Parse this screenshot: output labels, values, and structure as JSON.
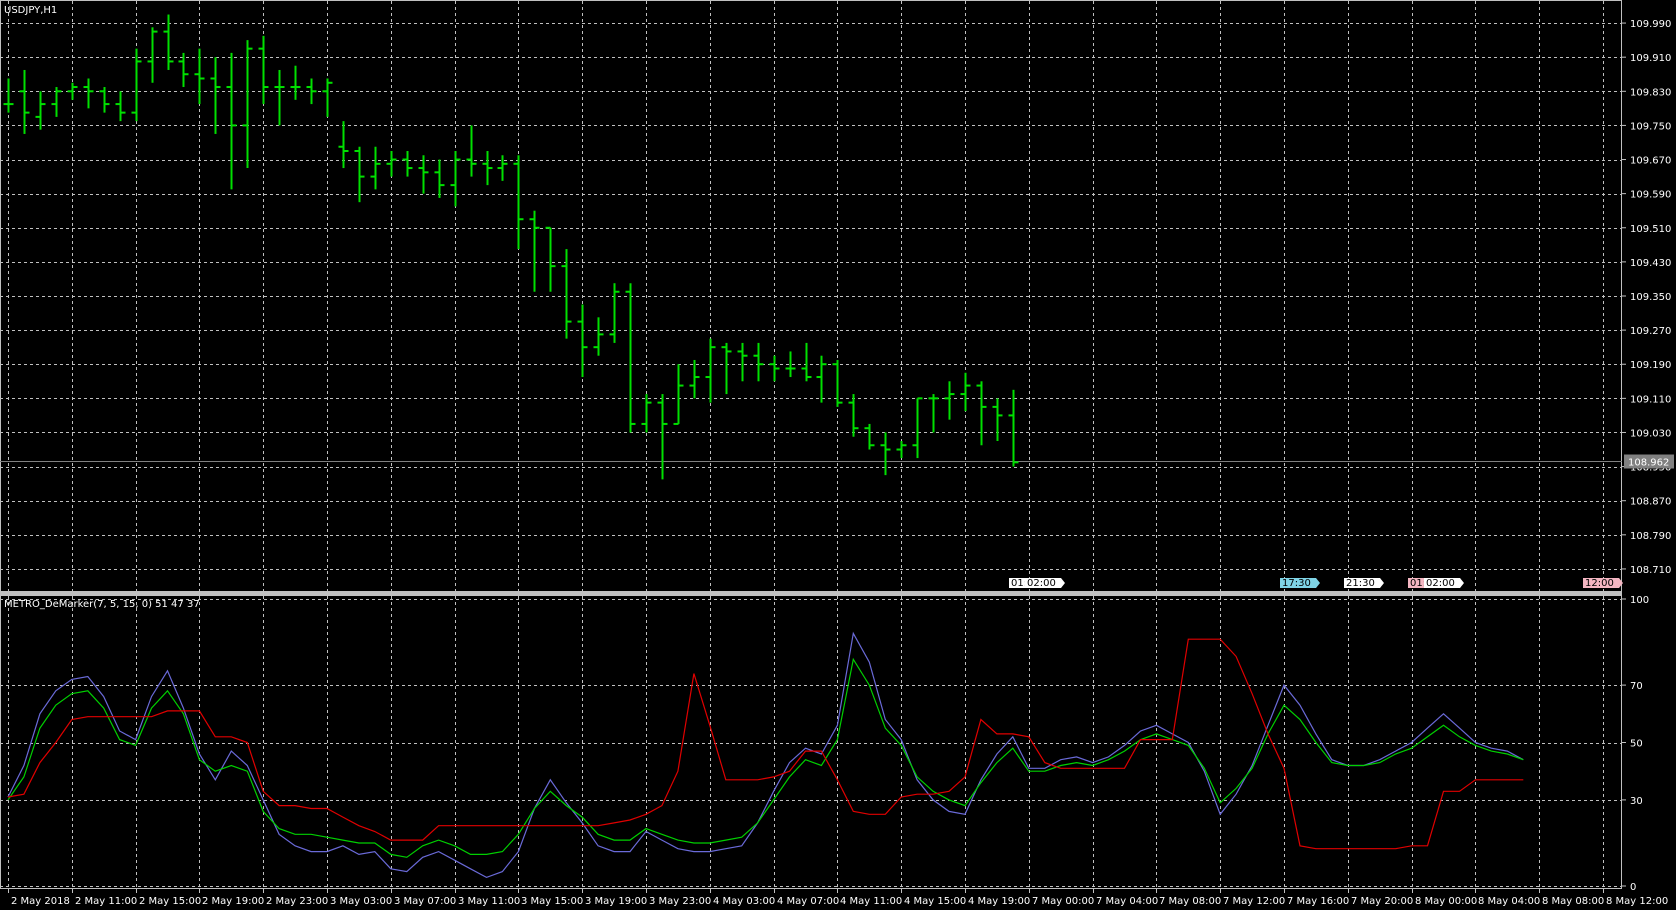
{
  "window": {
    "title": "USDJPY,H1"
  },
  "price_pane": {
    "y_ticks": [
      "109.990",
      "109.910",
      "109.830",
      "109.750",
      "109.670",
      "109.590",
      "109.510",
      "109.430",
      "109.350",
      "109.270",
      "109.190",
      "109.110",
      "109.030",
      "108.950",
      "108.870",
      "108.790",
      "108.710"
    ],
    "y_tick_values": [
      109.99,
      109.91,
      109.83,
      109.75,
      109.67,
      109.59,
      109.51,
      109.43,
      109.35,
      109.27,
      109.19,
      109.11,
      109.03,
      108.95,
      108.87,
      108.79,
      108.71
    ],
    "bid_line_value": 108.962,
    "bid_label": "108.962",
    "event_markers": [
      {
        "label": "01:",
        "bar": 63,
        "color": "#ffffff"
      },
      {
        "label": "02:00",
        "bar": 64,
        "color": "#ffffff"
      },
      {
        "label": "17:30",
        "bar": 80,
        "color": "#7fd4e6"
      },
      {
        "label": "21:30",
        "bar": 84,
        "color": "#ffffff"
      },
      {
        "label": "01:",
        "bar": 88,
        "color": "#f4b6c2"
      },
      {
        "label": "02:00",
        "bar": 89,
        "color": "#ffffff"
      },
      {
        "label": "12:00",
        "bar": 99,
        "color": "#f4b6c2"
      }
    ]
  },
  "indicator_pane": {
    "title": "METRO_DeMarker(7, 5, 15, 0) 51 47 37",
    "y_ticks": [
      "100",
      "70",
      "50",
      "30",
      "0"
    ],
    "y_tick_values": [
      100,
      70,
      50,
      30,
      0
    ]
  },
  "time_axis": [
    {
      "label": "2 May 2018",
      "bar": 0
    },
    {
      "label": "2 May 11:00",
      "bar": 4
    },
    {
      "label": "2 May 15:00",
      "bar": 8
    },
    {
      "label": "2 May 19:00",
      "bar": 12
    },
    {
      "label": "2 May 23:00",
      "bar": 16
    },
    {
      "label": "3 May 03:00",
      "bar": 20
    },
    {
      "label": "3 May 07:00",
      "bar": 24
    },
    {
      "label": "3 May 11:00",
      "bar": 28
    },
    {
      "label": "3 May 15:00",
      "bar": 32
    },
    {
      "label": "3 May 19:00",
      "bar": 36
    },
    {
      "label": "3 May 23:00",
      "bar": 40
    },
    {
      "label": "4 May 03:00",
      "bar": 44
    },
    {
      "label": "4 May 07:00",
      "bar": 48
    },
    {
      "label": "4 May 11:00",
      "bar": 52
    },
    {
      "label": "4 May 15:00",
      "bar": 56
    },
    {
      "label": "4 May 19:00",
      "bar": 60
    },
    {
      "label": "7 May 00:00",
      "bar": 64
    },
    {
      "label": "7 May 04:00",
      "bar": 68
    },
    {
      "label": "7 May 08:00",
      "bar": 72
    },
    {
      "label": "7 May 12:00",
      "bar": 76
    },
    {
      "label": "7 May 16:00",
      "bar": 80
    },
    {
      "label": "7 May 20:00",
      "bar": 84
    },
    {
      "label": "8 May 00:00",
      "bar": 88
    },
    {
      "label": "8 May 04:00",
      "bar": 92
    },
    {
      "label": "8 May 08:00",
      "bar": 96
    },
    {
      "label": "8 May 12:00",
      "bar": 100
    }
  ],
  "colors": {
    "background": "#000000",
    "grid": "#c0c0c0",
    "bars": "#00e000",
    "separator": "#c0c0c0",
    "bid_line": "#808080",
    "demarker_blue": "#6a6ad8",
    "demarker_green": "#00d000",
    "demarker_red": "#e00000"
  },
  "chart_data": [
    {
      "type": "ohlc",
      "symbol": "USDJPY",
      "timeframe": "H1",
      "ylim": [
        108.67,
        110.03
      ],
      "bars": [
        [
          109.8,
          109.86,
          109.78,
          109.8
        ],
        [
          109.83,
          109.88,
          109.73,
          109.78
        ],
        [
          109.77,
          109.83,
          109.74,
          109.8
        ],
        [
          109.8,
          109.84,
          109.77,
          109.83
        ],
        [
          109.83,
          109.85,
          109.81,
          109.84
        ],
        [
          109.84,
          109.86,
          109.79,
          109.83
        ],
        [
          109.83,
          109.84,
          109.78,
          109.8
        ],
        [
          109.8,
          109.83,
          109.76,
          109.78
        ],
        [
          109.78,
          109.93,
          109.76,
          109.9
        ],
        [
          109.9,
          109.98,
          109.85,
          109.97
        ],
        [
          109.97,
          110.01,
          109.88,
          109.9
        ],
        [
          109.9,
          109.92,
          109.84,
          109.87
        ],
        [
          109.87,
          109.93,
          109.8,
          109.86
        ],
        [
          109.86,
          109.91,
          109.73,
          109.84
        ],
        [
          109.84,
          109.92,
          109.6,
          109.75
        ],
        [
          109.75,
          109.95,
          109.65,
          109.93
        ],
        [
          109.93,
          109.96,
          109.8,
          109.84
        ],
        [
          109.84,
          109.88,
          109.75,
          109.84
        ],
        [
          109.84,
          109.89,
          109.81,
          109.84
        ],
        [
          109.84,
          109.86,
          109.8,
          109.83
        ],
        [
          109.83,
          109.86,
          109.77,
          109.85
        ],
        [
          109.7,
          109.76,
          109.65,
          109.69
        ],
        [
          109.69,
          109.7,
          109.57,
          109.63
        ],
        [
          109.63,
          109.7,
          109.6,
          109.66
        ],
        [
          109.66,
          109.69,
          109.63,
          109.67
        ],
        [
          109.67,
          109.69,
          109.63,
          109.65
        ],
        [
          109.65,
          109.68,
          109.59,
          109.64
        ],
        [
          109.64,
          109.67,
          109.58,
          109.61
        ],
        [
          109.61,
          109.69,
          109.56,
          109.67
        ],
        [
          109.67,
          109.75,
          109.63,
          109.66
        ],
        [
          109.66,
          109.69,
          109.61,
          109.65
        ],
        [
          109.65,
          109.68,
          109.62,
          109.66
        ],
        [
          109.66,
          109.68,
          109.46,
          109.53
        ],
        [
          109.53,
          109.55,
          109.36,
          109.51
        ],
        [
          109.51,
          109.47,
          109.36,
          109.42
        ],
        [
          109.42,
          109.46,
          109.25,
          109.29
        ],
        [
          109.29,
          109.33,
          109.16,
          109.23
        ],
        [
          109.23,
          109.3,
          109.21,
          109.26
        ],
        [
          109.26,
          109.38,
          109.24,
          109.36
        ],
        [
          109.36,
          109.38,
          109.03,
          109.05
        ],
        [
          109.05,
          109.12,
          109.03,
          109.1
        ],
        [
          109.1,
          109.12,
          108.92,
          109.05
        ],
        [
          109.05,
          109.19,
          109.05,
          109.14
        ],
        [
          109.14,
          109.2,
          109.11,
          109.16
        ],
        [
          109.16,
          109.25,
          109.1,
          109.23
        ],
        [
          109.23,
          109.24,
          109.12,
          109.22
        ],
        [
          109.22,
          109.24,
          109.15,
          109.21
        ],
        [
          109.21,
          109.24,
          109.15,
          109.19
        ],
        [
          109.19,
          109.21,
          109.15,
          109.18
        ],
        [
          109.18,
          109.22,
          109.16,
          109.18
        ],
        [
          109.18,
          109.24,
          109.15,
          109.16
        ],
        [
          109.16,
          109.21,
          109.1,
          109.19
        ],
        [
          109.19,
          109.2,
          109.09,
          109.1
        ],
        [
          109.1,
          109.12,
          109.02,
          109.04
        ],
        [
          109.04,
          109.05,
          108.99,
          109.0
        ],
        [
          109.0,
          109.03,
          108.93,
          108.99
        ],
        [
          108.99,
          109.01,
          108.97,
          109.0
        ],
        [
          109.0,
          109.08,
          108.97,
          109.11
        ],
        [
          109.11,
          109.12,
          109.03,
          109.11
        ],
        [
          109.11,
          109.15,
          109.06,
          109.12
        ],
        [
          109.12,
          109.17,
          109.08,
          109.14
        ],
        [
          109.14,
          109.15,
          109.0,
          109.09
        ],
        [
          109.09,
          109.11,
          109.01,
          109.07
        ],
        [
          109.07,
          109.13,
          108.95,
          108.96
        ]
      ]
    },
    {
      "type": "line",
      "title": "METRO_DeMarker(7, 5, 15, 0) 51 47 37",
      "ylim": [
        0,
        100
      ],
      "series": [
        {
          "values": [
            31,
            42,
            60,
            68,
            72,
            73,
            66,
            54,
            51,
            66,
            75,
            62,
            46,
            37,
            47,
            42,
            30,
            18,
            14,
            12,
            12,
            14,
            11,
            12,
            6,
            5,
            10,
            12,
            9,
            6,
            3,
            5,
            12,
            27,
            37,
            29,
            22,
            14,
            12,
            12,
            19,
            16,
            13,
            12,
            12,
            13,
            14,
            22,
            33,
            43,
            48,
            46,
            56,
            88,
            78,
            58,
            51,
            37,
            30,
            26,
            25,
            37,
            46,
            52,
            41,
            41,
            44,
            45,
            43,
            45,
            49,
            54,
            56,
            53,
            50,
            40,
            25,
            32,
            42,
            56,
            70,
            63,
            53,
            44,
            42,
            42,
            44,
            47,
            50,
            55,
            60,
            55,
            50,
            48,
            47,
            44
          ]
        },
        {
          "values": [
            30,
            38,
            55,
            63,
            67,
            68,
            62,
            51,
            49,
            62,
            68,
            60,
            44,
            40,
            42,
            40,
            26,
            20,
            18,
            18,
            17,
            16,
            15,
            15,
            11,
            10,
            14,
            16,
            14,
            11,
            11,
            12,
            18,
            27,
            33,
            28,
            24,
            18,
            16,
            16,
            20,
            18,
            16,
            15,
            15,
            16,
            17,
            22,
            30,
            38,
            44,
            42,
            51,
            79,
            70,
            55,
            49,
            38,
            33,
            30,
            28,
            36,
            43,
            48,
            40,
            40,
            42,
            43,
            42,
            44,
            47,
            51,
            53,
            51,
            49,
            41,
            29,
            34,
            41,
            53,
            63,
            58,
            50,
            43,
            42,
            42,
            43,
            46,
            48,
            52,
            56,
            52,
            49,
            47,
            46,
            44
          ]
        },
        {
          "values": [
            31,
            32,
            43,
            50,
            58,
            59,
            59,
            59,
            59,
            59,
            61,
            61,
            61,
            52,
            52,
            50,
            33,
            28,
            28,
            27,
            27,
            24,
            21,
            19,
            16,
            16,
            16,
            21,
            21,
            21,
            21,
            21,
            21,
            21,
            21,
            21,
            21,
            21,
            22,
            23,
            25,
            28,
            40,
            74,
            56,
            37,
            37,
            37,
            38,
            40,
            47,
            47,
            37,
            26,
            25,
            25,
            31,
            32,
            32,
            33,
            38,
            58,
            53,
            53,
            52,
            43,
            41,
            41,
            41,
            41,
            41,
            51,
            51,
            51,
            86,
            86,
            86,
            80,
            67,
            53,
            41,
            14,
            13,
            13,
            13,
            13,
            13,
            13,
            14,
            14,
            33,
            33,
            37,
            37,
            37,
            37
          ]
        }
      ]
    }
  ]
}
